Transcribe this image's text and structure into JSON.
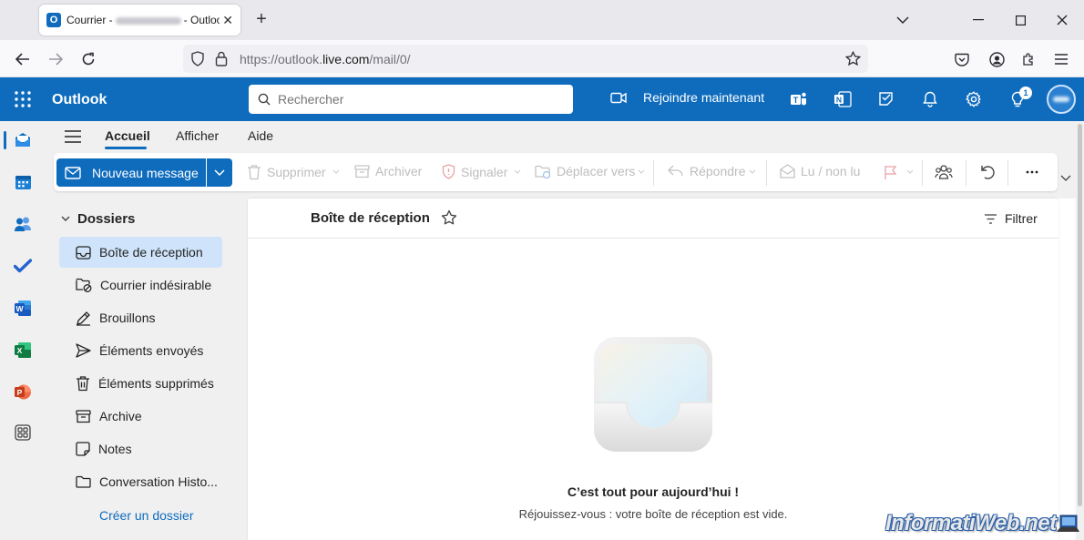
{
  "browser": {
    "tab_title_prefix": "Courrier -",
    "tab_title_suffix": "- Outlook",
    "url_prefix": "https://outlook.",
    "url_domain": "live.com",
    "url_path": "/mail/0/"
  },
  "header": {
    "brand": "Outlook",
    "search_placeholder": "Rechercher",
    "join_label": "Rejoindre maintenant",
    "notification_count": "1",
    "accent": "#0f6cbd"
  },
  "ribbon": {
    "tabs": [
      "Accueil",
      "Afficher",
      "Aide"
    ],
    "new_message": "Nouveau message",
    "delete": "Supprimer",
    "archive": "Archiver",
    "report": "Signaler",
    "move": "Déplacer vers",
    "reply": "Répondre",
    "read_unread": "Lu / non lu"
  },
  "folders": {
    "header": "Dossiers",
    "items": [
      {
        "label": "Boîte de réception",
        "icon": "inbox-icon"
      },
      {
        "label": "Courrier indésirable",
        "icon": "junk-icon"
      },
      {
        "label": "Brouillons",
        "icon": "drafts-icon"
      },
      {
        "label": "Éléments envoyés",
        "icon": "sent-icon"
      },
      {
        "label": "Éléments supprimés",
        "icon": "trash-icon"
      },
      {
        "label": "Archive",
        "icon": "archive-icon"
      },
      {
        "label": "Notes",
        "icon": "notes-icon"
      },
      {
        "label": "Conversation Histo...",
        "icon": "folder-icon"
      }
    ],
    "create": "Créer un dossier"
  },
  "main": {
    "title": "Boîte de réception",
    "filter": "Filtrer",
    "empty_title": "C’est tout pour aujourd’hui !",
    "empty_subtitle": "Réjouissez-vous : votre boîte de réception est vide."
  },
  "watermark": "InformatiWeb.net"
}
